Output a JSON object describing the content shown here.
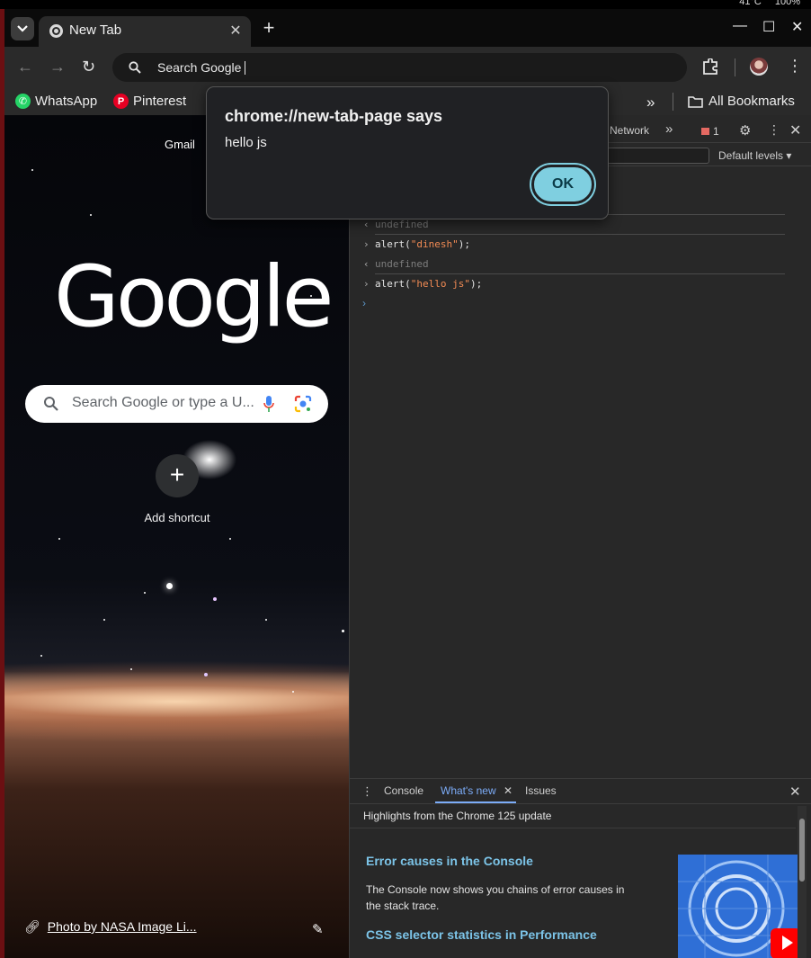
{
  "os_tray": {
    "temperature": "41°C",
    "battery": "100%"
  },
  "browser": {
    "tab_title": "New Tab",
    "omnibox_text": "Search Google",
    "bookmarks": [
      {
        "label": "WhatsApp",
        "icon": "whatsapp-icon",
        "color": "#25d366"
      },
      {
        "label": "Pinterest",
        "icon": "pinterest-icon",
        "color": "#e60023"
      }
    ],
    "bookmarks_overflow": "»",
    "all_bookmarks": "All Bookmarks"
  },
  "page": {
    "gmail": "Gmail",
    "logo": "Google",
    "search_placeholder": "Search Google or type a U...",
    "add_shortcut": "Add shortcut",
    "photo_credit": "Photo by NASA Image Li..."
  },
  "devtools": {
    "network_tab": "Network",
    "more_tabs": "»",
    "issues_count": "1",
    "levels": "Default levels ▾",
    "console_lines": [
      {
        "type": "result",
        "arrow": "‹",
        "text": "undefined"
      },
      {
        "type": "input",
        "arrow": "›",
        "prefix": "alert(",
        "string": "\"dinesh\"",
        "suffix": ");"
      },
      {
        "type": "result",
        "arrow": "‹",
        "text": "undefined"
      },
      {
        "type": "input",
        "arrow": "›",
        "prefix": "alert(",
        "string": "\"hello js\"",
        "suffix": ");"
      }
    ],
    "prompt": "›",
    "drawer": {
      "tabs": [
        "Console",
        "What's new",
        "Issues"
      ],
      "active_tab": "What's new",
      "subtitle": "Highlights from the Chrome 125 update",
      "heading1": "Error causes in the Console",
      "paragraph1": "The Console now shows you chains of error causes in the stack trace.",
      "heading2": "CSS selector statistics in Performance"
    }
  },
  "dialog": {
    "title": "chrome://new-tab-page says",
    "message": "hello js",
    "ok_label": "OK"
  },
  "colors": {
    "accent_ok": "#7fcfe0",
    "devtools_link": "#7cc4e8",
    "active_tab": "#7cacf8",
    "string": "#f28b54"
  }
}
